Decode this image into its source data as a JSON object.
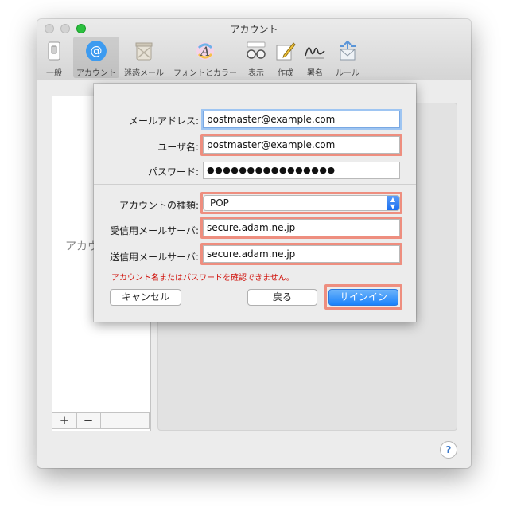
{
  "window": {
    "title": "アカウント"
  },
  "toolbar": {
    "items": [
      {
        "label": "一般",
        "icon": "switch-icon"
      },
      {
        "label": "アカウント",
        "icon": "at-sign-icon",
        "active": true
      },
      {
        "label": "迷惑メール",
        "icon": "junk-trash-icon"
      },
      {
        "label": "フォントとカラー",
        "icon": "font-color-icon"
      },
      {
        "label": "表示",
        "icon": "glasses-icon"
      },
      {
        "label": "作成",
        "icon": "compose-pencil-icon"
      },
      {
        "label": "署名",
        "icon": "signature-icon"
      },
      {
        "label": "ルール",
        "icon": "rules-envelope-icon"
      }
    ]
  },
  "left_pane": {
    "placeholder_text": "アカウ"
  },
  "pane_buttons": {
    "add": "+",
    "remove": "−"
  },
  "sheet": {
    "email_label": "メールアドレス:",
    "email_value": "postmaster@example.com",
    "username_label": "ユーザ名:",
    "username_value": "postmaster@example.com",
    "password_label": "パスワード:",
    "password_value": "●●●●●●●●●●●●●●●●",
    "account_type_label": "アカウントの種類:",
    "account_type_value": "POP",
    "incoming_label": "受信用メールサーバ:",
    "incoming_value": "secure.adam.ne.jp",
    "outgoing_label": "送信用メールサーバ:",
    "outgoing_value": "secure.adam.ne.jp",
    "error_message": "アカウント名またはパスワードを確認できません。",
    "cancel_label": "キャンセル",
    "back_label": "戻る",
    "signin_label": "サインイン"
  },
  "help": {
    "label": "?"
  },
  "colors": {
    "highlight": "#ee8e7f",
    "error": "#d0120b",
    "accent": "#1a82fb",
    "zoom_button": "#2bc03f"
  }
}
